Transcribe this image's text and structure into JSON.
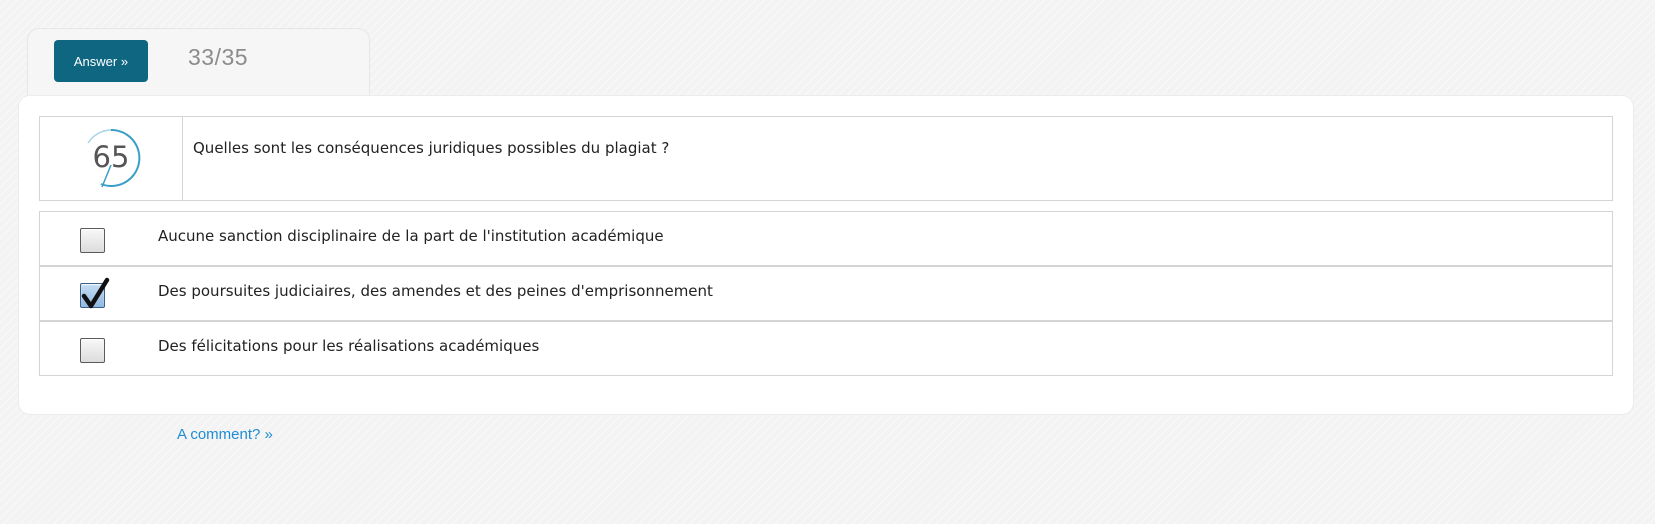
{
  "header": {
    "answer_button_label": "Answer »",
    "progress_counter": "33/35"
  },
  "question": {
    "logo_text": "65",
    "text": "Quelles sont les conséquences juridiques possibles du plagiat ?"
  },
  "options": [
    {
      "text": "Aucune sanction disciplinaire de la part de l'institution académique",
      "checked": false
    },
    {
      "text": "Des poursuites judiciaires, des amendes et des peines d'emprisonnement",
      "checked": true
    },
    {
      "text": "Des félicitations pour les réalisations académiques",
      "checked": false
    }
  ],
  "footer": {
    "comment_link": "A comment? »"
  },
  "colors": {
    "accent": "#0f6680",
    "link": "#1f8dd6",
    "logo_ring": "#3a9fc8",
    "logo_text": "#555555"
  }
}
